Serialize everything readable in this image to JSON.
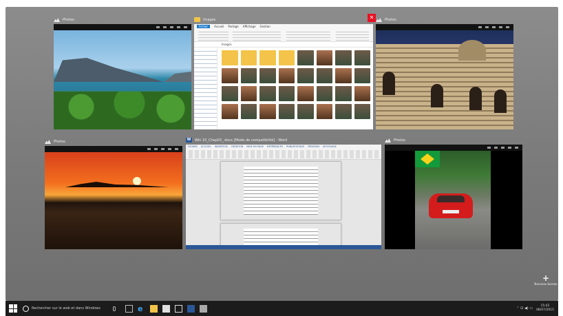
{
  "windows": {
    "photo1": {
      "title": "Photos"
    },
    "explorer": {
      "title": "Images",
      "tabs": [
        "Fichier",
        "Accueil",
        "Partage",
        "Affichage",
        "Gestion"
      ],
      "address": "Images"
    },
    "photo3": {
      "title": "Photos"
    },
    "photo4": {
      "title": "Photos"
    },
    "word": {
      "title": "Win 10_Chap03_.docx [Mode de compatibilité] - Word",
      "tabs": [
        "FICHIER",
        "ACCUEIL",
        "INSERTION",
        "CRÉATION",
        "MISE EN PAGE",
        "RÉFÉRENCES",
        "PUBLIPOSTAGE",
        "RÉVISION",
        "AFFICHAGE"
      ]
    },
    "photo6": {
      "title": "Photos"
    }
  },
  "new_desktop": {
    "plus": "+",
    "label": "Nouveau bureau"
  },
  "taskbar": {
    "search_placeholder": "Rechercher sur le web et dans Windows",
    "tray_icons": "⌃  ⊡  ◀)  ▭",
    "time": "15:42",
    "date": "08/07/2015"
  },
  "colors": {
    "accent": "#2b5797",
    "close": "#e81123",
    "folder": "#f3c449"
  }
}
